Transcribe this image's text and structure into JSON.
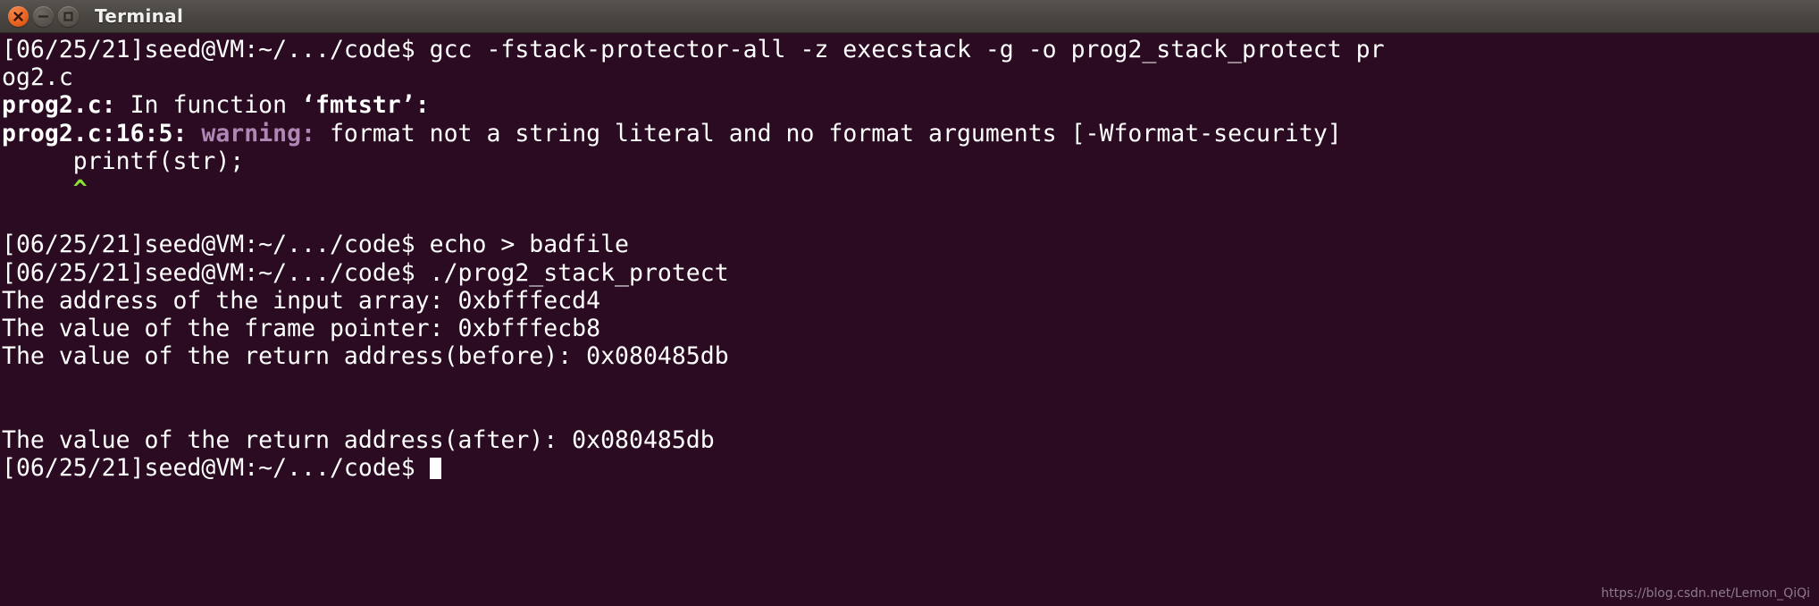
{
  "window": {
    "title": "Terminal",
    "controls": [
      {
        "name": "close",
        "icon": "close-icon",
        "color": "#e8601d"
      },
      {
        "name": "minimize",
        "icon": "minimize-icon",
        "color": "#57534d"
      },
      {
        "name": "maximize",
        "icon": "maximize-icon",
        "color": "#57534d"
      }
    ]
  },
  "theme": {
    "background": "#2a0b21",
    "foreground": "#ffffff",
    "warning_color": "#b087b4",
    "caret_color": "#8ae234",
    "titlebar_color": "#4a4642"
  },
  "terminal": {
    "prompt": "[06/25/21]seed@VM:~/.../code$",
    "lines": [
      {
        "id": "cmd-gcc",
        "text": "[06/25/21]seed@VM:~/.../code$ gcc -fstack-protector-all -z execstack -g -o prog2_stack_protect pr"
      },
      {
        "id": "cmd-gcc-wrap",
        "text": "og2.c"
      },
      {
        "id": "gcc-infile-prefix",
        "text": "prog2.c:"
      },
      {
        "id": "gcc-infile-mid",
        "text": " In function "
      },
      {
        "id": "gcc-infile-func",
        "text": "‘fmtstr’:"
      },
      {
        "id": "gcc-warn-loc",
        "text": "prog2.c:16:5:"
      },
      {
        "id": "gcc-warn-kw",
        "text": " warning:"
      },
      {
        "id": "gcc-warn-msg",
        "text": " format not a string literal and no format arguments [-Wformat-security]"
      },
      {
        "id": "gcc-src-line",
        "text": "     printf(str);"
      },
      {
        "id": "gcc-caret",
        "text": "     ^"
      },
      {
        "id": "blank-1",
        "text": ""
      },
      {
        "id": "cmd-echo",
        "text": "[06/25/21]seed@VM:~/.../code$ echo > badfile"
      },
      {
        "id": "cmd-run",
        "text": "[06/25/21]seed@VM:~/.../code$ ./prog2_stack_protect"
      },
      {
        "id": "out-input-array",
        "text": "The address of the input array: 0xbfffecd4"
      },
      {
        "id": "out-frame-pointer",
        "text": "The value of the frame pointer: 0xbfffecb8"
      },
      {
        "id": "out-ret-before",
        "text": "The value of the return address(before): 0x080485db"
      },
      {
        "id": "blank-2",
        "text": ""
      },
      {
        "id": "blank-3",
        "text": ""
      },
      {
        "id": "out-ret-after",
        "text": "The value of the return address(after): 0x080485db"
      },
      {
        "id": "prompt-final",
        "text": "[06/25/21]seed@VM:~/.../code$ "
      }
    ],
    "values": {
      "input_array_address": "0xbfffecd4",
      "frame_pointer": "0xbfffecb8",
      "return_address_before": "0x080485db",
      "return_address_after": "0x080485db",
      "source_file": "prog2.c",
      "function_name": "fmtstr",
      "warning_location": "prog2.c:16:5",
      "warning_flag": "-Wformat-security",
      "output_binary": "prog2_stack_protect",
      "compile_flags": "-fstack-protector-all -z execstack -g"
    }
  },
  "watermark": {
    "text": "https://blog.csdn.net/Lemon_QiQi"
  }
}
